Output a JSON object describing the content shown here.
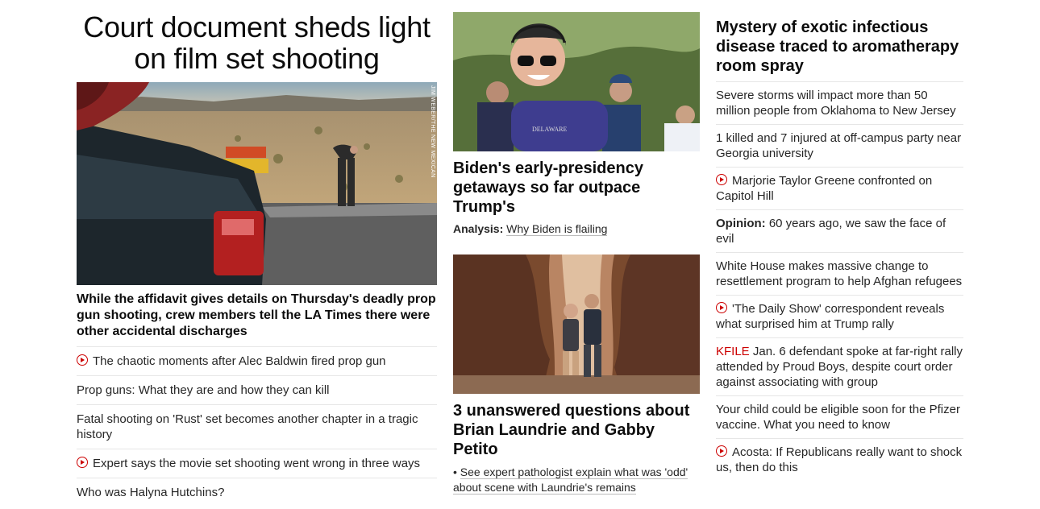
{
  "left": {
    "headline": "Court document sheds light on film set shooting",
    "photo_credit": "JIM WEBER/THE NEW MEXICAN",
    "subheadline": "While the affidavit gives details on Thursday's deadly prop gun shooting, crew members tell the LA Times there were other accidental discharges",
    "links": [
      {
        "text": "The chaotic moments after Alec Baldwin fired prop gun",
        "video": true
      },
      {
        "text": "Prop guns: What they are and how they can kill",
        "video": false
      },
      {
        "text": "Fatal shooting on 'Rust' set becomes another chapter in a tragic history",
        "video": false
      },
      {
        "text": "Expert says the movie set shooting went wrong in three ways",
        "video": true
      },
      {
        "text": "Who was Halyna Hutchins?",
        "video": false
      }
    ]
  },
  "middle": {
    "story1": {
      "headline": "Biden's early-presidency getaways so far outpace Trump's",
      "analysis_label": "Analysis:",
      "analysis_link": "Why Biden is flailing",
      "shirt_text": "DELAWARE"
    },
    "story2": {
      "headline": "3 unanswered questions about Brian Laundrie and Gabby Petito",
      "bullet": "•",
      "bullet_link": "See expert pathologist explain what was 'odd' about scene with Laundrie's remains"
    }
  },
  "right": {
    "headline": "Mystery of exotic infectious disease traced to aromatherapy room spray",
    "items": [
      {
        "prefix": "",
        "text": "Severe storms will impact more than 50 million people from Oklahoma to New Jersey",
        "video": false
      },
      {
        "prefix": "",
        "text": "1 killed and 7 injured at off-campus party near Georgia university",
        "video": false
      },
      {
        "prefix": "",
        "text": "Marjorie Taylor Greene confronted on Capitol Hill",
        "video": true
      },
      {
        "prefix": "Opinion:",
        "text": "60 years ago, we saw the face of evil",
        "video": false
      },
      {
        "prefix": "",
        "text": "White House makes massive change to resettlement program to help Afghan refugees",
        "video": false
      },
      {
        "prefix": "",
        "text": "'The Daily Show' correspondent reveals what surprised him at Trump rally",
        "video": true
      },
      {
        "prefix": "KFILE",
        "text": "Jan. 6 defendant spoke at far-right rally attended by Proud Boys, despite court order against associating with group",
        "video": false
      },
      {
        "prefix": "",
        "text": "Your child could be eligible soon for the Pfizer vaccine. What you need to know",
        "video": false
      },
      {
        "prefix": "",
        "text": "Acosta: If Republicans really want to shock us, then do this",
        "video": true
      }
    ]
  },
  "icons": {
    "video": "play-circle-icon"
  },
  "colors": {
    "accent": "#cc0000",
    "text": "#0c0c0c",
    "divider": "#e6e6e6"
  }
}
